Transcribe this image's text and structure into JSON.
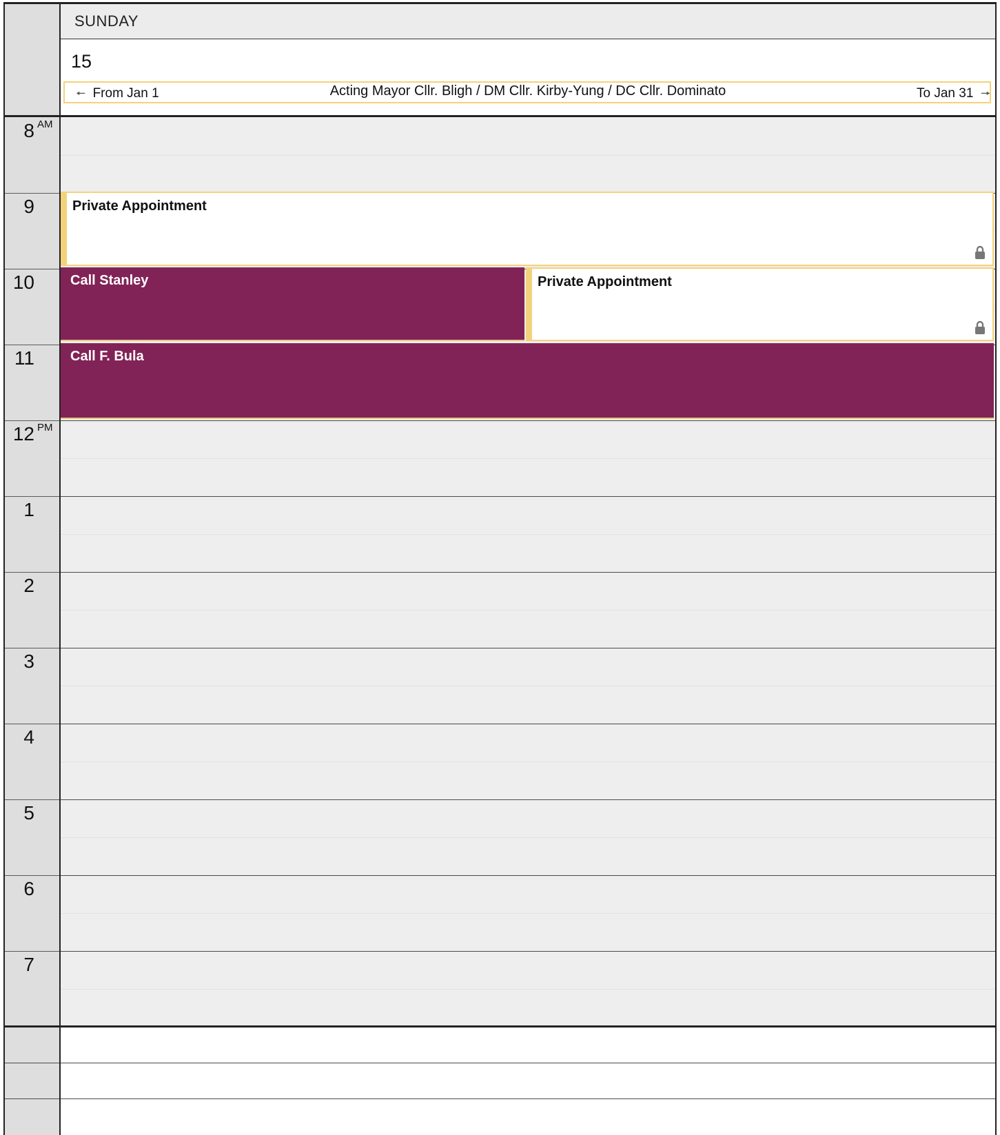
{
  "day": {
    "name": "SUNDAY",
    "number": "15"
  },
  "banner": {
    "from_label": "From Jan 1",
    "title": "Acting Mayor Cllr. Bligh / DM Cllr. Kirby-Yung / DC Cllr. Dominato",
    "to_label": "To Jan 31",
    "color": "#f3d27a"
  },
  "times": [
    {
      "hour": "8",
      "suffix": "AM"
    },
    {
      "hour": "9",
      "suffix": ""
    },
    {
      "hour": "10",
      "suffix": ""
    },
    {
      "hour": "11",
      "suffix": ""
    },
    {
      "hour": "12",
      "suffix": "PM"
    },
    {
      "hour": "1",
      "suffix": ""
    },
    {
      "hour": "2",
      "suffix": ""
    },
    {
      "hour": "3",
      "suffix": ""
    },
    {
      "hour": "4",
      "suffix": ""
    },
    {
      "hour": "5",
      "suffix": ""
    },
    {
      "hour": "6",
      "suffix": ""
    },
    {
      "hour": "7",
      "suffix": ""
    }
  ],
  "events": [
    {
      "title": "Private Appointment",
      "type": "private",
      "locked": true,
      "color": "#f3d27a"
    },
    {
      "title": "Call Stanley",
      "type": "call",
      "locked": false,
      "color": "#822357"
    },
    {
      "title": "Private Appointment",
      "type": "private",
      "locked": true,
      "color": "#f3d27a"
    },
    {
      "title": "Call F. Bula",
      "type": "call",
      "locked": false,
      "color": "#822357"
    }
  ],
  "icons": {
    "prev": "arrow-left-icon",
    "next": "arrow-right-icon",
    "lock": "lock-icon"
  }
}
